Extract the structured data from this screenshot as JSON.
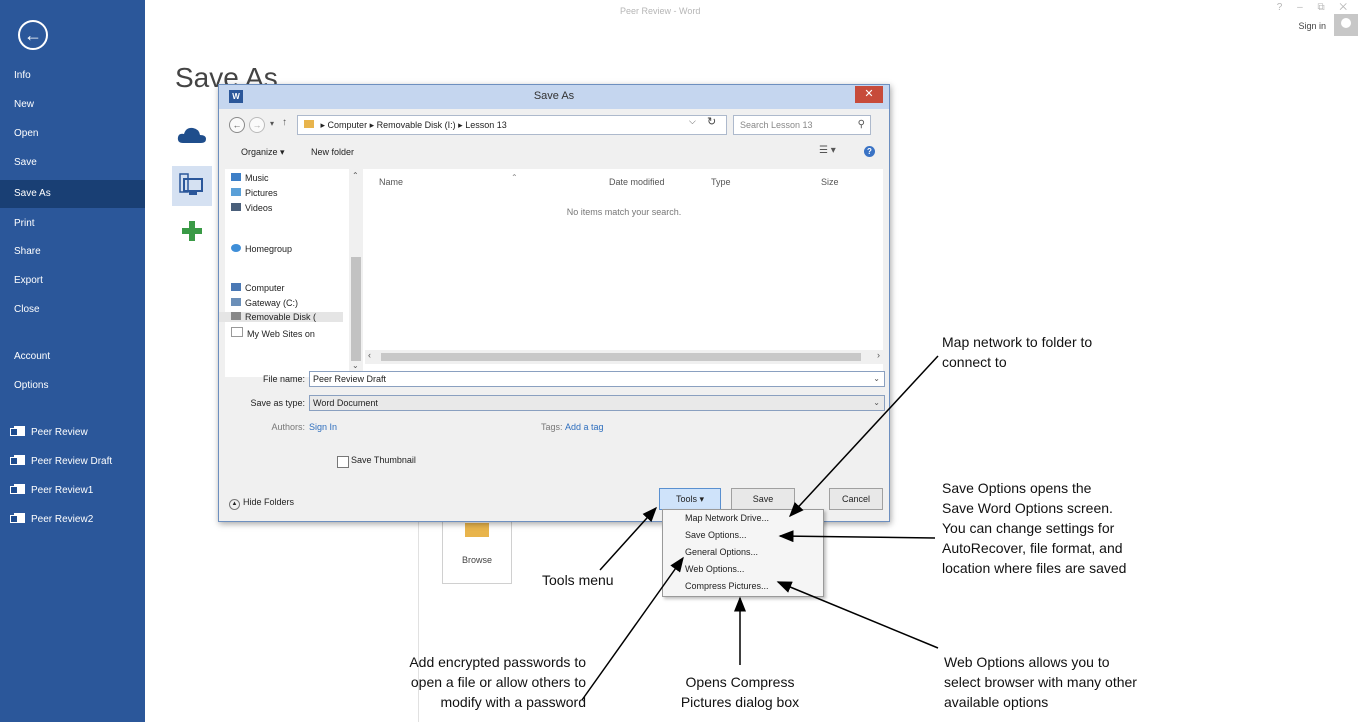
{
  "window": {
    "title": "Peer Review - Word",
    "controls": "? – ⧉ ✕",
    "sign_in": "Sign in"
  },
  "sidebar": {
    "back_icon": "back-arrow-icon",
    "items": [
      {
        "label": "Info"
      },
      {
        "label": "New"
      },
      {
        "label": "Open"
      },
      {
        "label": "Save"
      },
      {
        "label": "Save As"
      },
      {
        "label": "Print"
      },
      {
        "label": "Share"
      },
      {
        "label": "Export"
      },
      {
        "label": "Close"
      },
      {
        "label": "Account"
      },
      {
        "label": "Options"
      }
    ],
    "recent": [
      {
        "label": "Peer Review"
      },
      {
        "label": "Peer Review Draft"
      },
      {
        "label": "Peer Review1"
      },
      {
        "label": "Peer Review2"
      }
    ],
    "active": "Save As"
  },
  "main": {
    "title": "Save As",
    "browse_label": "Browse"
  },
  "dialog": {
    "title": "Save As",
    "address": [
      "Computer",
      "Removable Disk (I:)",
      "Lesson 13"
    ],
    "search_placeholder": "Search Lesson 13",
    "organize": "Organize ▾",
    "new_folder": "New folder",
    "nav_items": [
      {
        "label": "Music"
      },
      {
        "label": "Pictures"
      },
      {
        "label": "Videos"
      },
      {
        "label": "Homegroup"
      },
      {
        "label": "Computer"
      },
      {
        "label": "Gateway (C:)"
      },
      {
        "label": "Removable Disk ("
      },
      {
        "label": "My Web Sites on"
      }
    ],
    "columns": [
      "Name",
      "Date modified",
      "Type",
      "Size"
    ],
    "empty_message": "No items match your search.",
    "file_name_label": "File name:",
    "file_name_value": "Peer Review Draft",
    "save_type_label": "Save as type:",
    "save_type_value": "Word Document",
    "authors_label": "Authors:",
    "authors_value": "Sign In",
    "tags_label": "Tags:",
    "tags_value": "Add a tag",
    "thumbnail_label": "Save Thumbnail",
    "hide_folders": "Hide Folders",
    "tools_button": "Tools",
    "save_button": "Save",
    "cancel_button": "Cancel",
    "tools_menu": [
      {
        "label": "Map Network Drive..."
      },
      {
        "label": "Save Options..."
      },
      {
        "label": "General Options..."
      },
      {
        "label": "Web Options..."
      },
      {
        "label": "Compress Pictures..."
      }
    ]
  },
  "callouts": {
    "map_network": [
      "Map network to folder to",
      "connect to"
    ],
    "save_options": [
      "Save Options opens the",
      "Save Word Options screen.",
      "You can change settings for",
      "AutoRecover, file format, and",
      "location where files are saved"
    ],
    "tools_menu": [
      "Tools menu"
    ],
    "general_options": [
      "Add encrypted passwords to",
      "open a file or allow others to",
      "modify with a password"
    ],
    "compress": [
      "Opens Compress",
      "Pictures dialog box"
    ],
    "web_options": [
      "Web Options allows you to",
      "select browser with many other",
      "available options"
    ]
  }
}
